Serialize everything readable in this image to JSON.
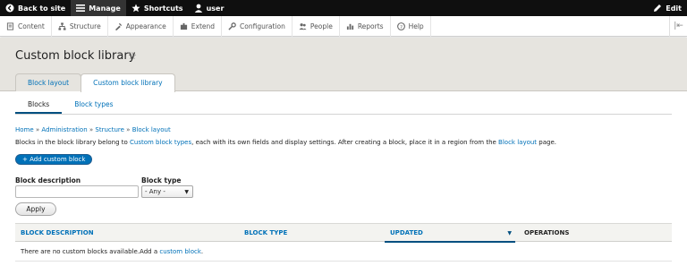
{
  "toolbar": {
    "back_label": "Back to site",
    "manage_label": "Manage",
    "shortcuts_label": "Shortcuts",
    "user_label": "user",
    "edit_label": "Edit"
  },
  "tray": {
    "items": [
      {
        "label": "Content",
        "icon": "content-icon"
      },
      {
        "label": "Structure",
        "icon": "structure-icon"
      },
      {
        "label": "Appearance",
        "icon": "appearance-icon"
      },
      {
        "label": "Extend",
        "icon": "extend-icon"
      },
      {
        "label": "Configuration",
        "icon": "configuration-icon"
      },
      {
        "label": "People",
        "icon": "people-icon"
      },
      {
        "label": "Reports",
        "icon": "reports-icon"
      },
      {
        "label": "Help",
        "icon": "help-icon"
      }
    ]
  },
  "page": {
    "title": "Custom block library",
    "primary_tabs": [
      "Block layout",
      "Custom block library"
    ],
    "secondary_tabs": [
      "Blocks",
      "Block types"
    ]
  },
  "breadcrumb": [
    "Home",
    "Administration",
    "Structure",
    "Block layout"
  ],
  "intro": {
    "prefix": "Blocks in the block library belong to ",
    "link1": "Custom block types",
    "middle": ", each with its own fields and display settings. After creating a block, place it in a region from the ",
    "link2": "Block layout",
    "suffix": " page."
  },
  "add_button": "+ Add custom block",
  "filters": {
    "description_label": "Block description",
    "description_value": "",
    "type_label": "Block type",
    "type_value": "- Any -",
    "apply_label": "Apply"
  },
  "table": {
    "headers": [
      "BLOCK DESCRIPTION",
      "BLOCK TYPE",
      "UPDATED",
      "OPERATIONS"
    ],
    "empty_text": "There are no custom blocks available.",
    "empty_add": "Add a ",
    "empty_link": "custom block",
    "empty_end": "."
  },
  "colors": {
    "link": "#0071b8",
    "toolbar_bg": "#0f0f0f",
    "header_bg": "#e6e4df",
    "primary_button": "#0071b8"
  }
}
